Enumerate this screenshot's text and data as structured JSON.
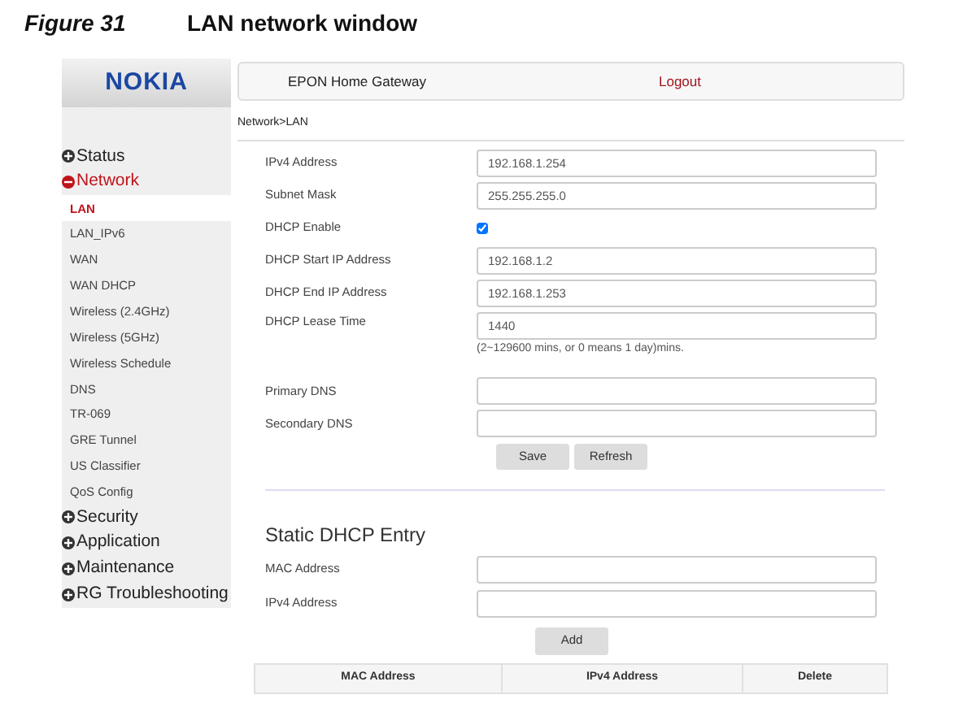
{
  "caption": {
    "figure": "Figure 31",
    "title": "LAN network window"
  },
  "logo": "NOKIA",
  "header": {
    "title": "EPON Home Gateway",
    "logout": "Logout"
  },
  "sidebar": {
    "items": [
      {
        "label": "Status",
        "expanded": false
      },
      {
        "label": "Network",
        "expanded": true,
        "children": [
          {
            "label": "LAN",
            "selected": true
          },
          {
            "label": "LAN_IPv6",
            "selected": false
          },
          {
            "label": "WAN",
            "selected": false
          },
          {
            "label": "WAN DHCP",
            "selected": false
          },
          {
            "label": "Wireless (2.4GHz)",
            "selected": false
          },
          {
            "label": "Wireless (5GHz)",
            "selected": false
          },
          {
            "label": "Wireless Schedule",
            "selected": false
          },
          {
            "label": "DNS",
            "selected": false
          },
          {
            "label": "TR-069",
            "selected": false
          },
          {
            "label": "GRE Tunnel",
            "selected": false
          },
          {
            "label": "US Classifier",
            "selected": false
          },
          {
            "label": "QoS Config",
            "selected": false
          }
        ]
      },
      {
        "label": "Security",
        "expanded": false
      },
      {
        "label": "Application",
        "expanded": false
      },
      {
        "label": "Maintenance",
        "expanded": false
      },
      {
        "label": "RG Troubleshooting",
        "expanded": false
      }
    ]
  },
  "breadcrumb": "Network>LAN",
  "form": {
    "fields": [
      {
        "kind": "text",
        "label": "IPv4 Address",
        "value": "192.168.1.254"
      },
      {
        "kind": "text",
        "label": "Subnet Mask",
        "value": "255.255.255.0"
      },
      {
        "kind": "checkbox",
        "label": "DHCP Enable",
        "checked": true
      },
      {
        "kind": "text",
        "label": "DHCP Start IP Address",
        "value": "192.168.1.2"
      },
      {
        "kind": "text",
        "label": "DHCP End IP Address",
        "value": "192.168.1.253"
      },
      {
        "kind": "text",
        "label": "DHCP Lease Time",
        "value": "1440",
        "hint": "(2~129600 mins, or 0 means 1 day)mins."
      },
      {
        "kind": "text",
        "label": "Primary DNS"
      },
      {
        "kind": "text",
        "label": "Secondary DNS"
      }
    ],
    "buttons": [
      "Save",
      "Refresh"
    ]
  },
  "static_dhcp": {
    "heading": "Static DHCP Entry",
    "fields": [
      {
        "label": "MAC Address"
      },
      {
        "label": "IPv4 Address"
      }
    ],
    "button": "Add",
    "table": {
      "columns": [
        "MAC Address",
        "IPv4 Address",
        "Delete"
      ]
    }
  }
}
